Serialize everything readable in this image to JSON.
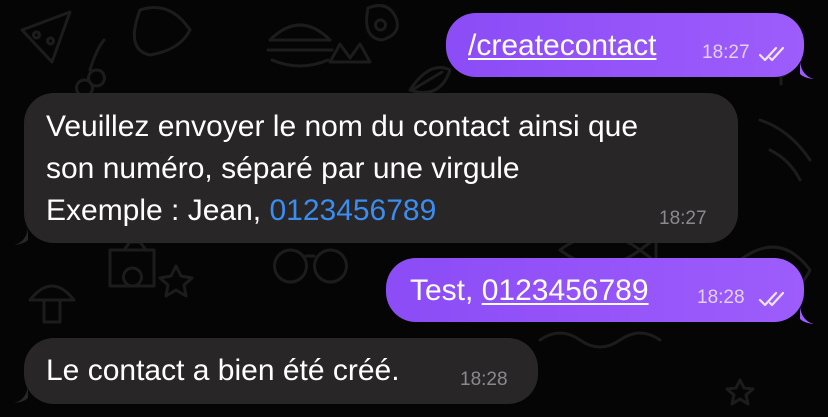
{
  "colors": {
    "outgoing_bubble": "#9454f8",
    "incoming_bubble": "#282627",
    "phone_link": "#3b8df1",
    "background": "#050505"
  },
  "wallpaper_icons": [
    "doodle-pattern"
  ],
  "messages": [
    {
      "direction": "outgoing",
      "command": "/createcontact",
      "time": "18:27",
      "status": "read-double-check"
    },
    {
      "direction": "incoming",
      "line1": "Veuillez envoyer le nom du contact ainsi que",
      "line2": "son numéro, séparé par une virgule",
      "line3_prefix": "Exemple : Jean, ",
      "phone": "0123456789",
      "time": "18:27"
    },
    {
      "direction": "outgoing",
      "prefix": "Test, ",
      "phone": "0123456789",
      "time": "18:28",
      "status": "read-double-check"
    },
    {
      "direction": "incoming",
      "text": "Le contact a bien été créé.",
      "time": "18:28"
    }
  ]
}
